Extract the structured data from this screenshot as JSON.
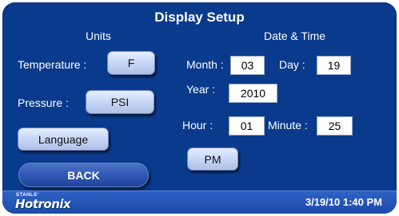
{
  "title": "Display Setup",
  "units": {
    "heading": "Units",
    "temperature_label": "Temperature :",
    "temperature_value": "F",
    "pressure_label": "Pressure :",
    "pressure_value": "PSI",
    "language_label": "Language"
  },
  "datetime": {
    "heading": "Date & Time",
    "month_label": "Month :",
    "month_value": "03",
    "day_label": "Day :",
    "day_value": "19",
    "year_label": "Year :",
    "year_value": "2010",
    "hour_label": "Hour :",
    "hour_value": "01",
    "minute_label": "Minute :",
    "minute_value": "25",
    "ampm_value": "PM"
  },
  "back_label": "BACK",
  "footer": {
    "logo_small": "STAHLS'",
    "logo_main": "Hotronix",
    "clock": "3/19/10  1:40 PM"
  },
  "colors": {
    "screen_bg": "#0a3a8c",
    "button_face": "#c4d4f4",
    "back_button": "#2e56b3",
    "footer_bar": "#1c4aa8"
  }
}
